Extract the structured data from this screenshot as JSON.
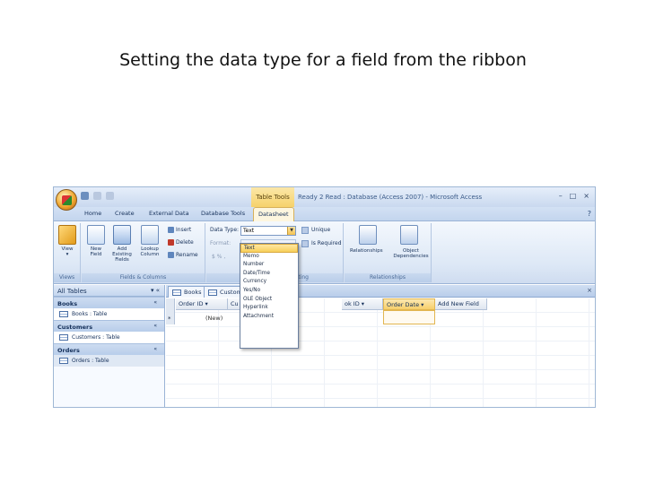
{
  "slide": {
    "title": "Setting the data type for a field from the ribbon"
  },
  "window": {
    "tool_context": "Table Tools",
    "title": "Ready 2 Read : Database (Access 2007) - Microsoft Access",
    "controls": [
      "–",
      "□",
      "×"
    ],
    "help": "?"
  },
  "ribbon": {
    "tabs": [
      "Home",
      "Create",
      "External Data",
      "Database Tools",
      "Datasheet"
    ],
    "active_tab": "Datasheet",
    "groups": {
      "views": {
        "label": "Views",
        "view_button": "View",
        "view_sub": "▾"
      },
      "fields_columns": {
        "label": "Fields & Columns",
        "new_field": "New Field",
        "add_existing": "Add Existing Fields",
        "lookup_column": "Lookup Column",
        "insert": "Insert",
        "delete": "Delete",
        "rename": "Rename"
      },
      "data_type": {
        "label_suffix": "ting",
        "data_type_label": "Data Type:",
        "data_type_value": "Text",
        "format_label": "Format:",
        "unique": "Unique",
        "is_required": "Is Required",
        "num_format": "$ % ,"
      },
      "relationships": {
        "label": "Relationships",
        "relationships": "Relationships",
        "object_dependencies": "Object Dependencies"
      }
    },
    "dropdown_options": [
      "Text",
      "Memo",
      "Number",
      "Date/Time",
      "Currency",
      "Yes/No",
      "OLE Object",
      "Hyperlink",
      "Attachment"
    ],
    "dropdown_selected": "Text"
  },
  "nav_pane": {
    "header": "All Tables",
    "header_ctrl": "▾  «",
    "groups": [
      {
        "name": "Books",
        "item": "Books : Table"
      },
      {
        "name": "Customers",
        "item": "Customers : Table"
      },
      {
        "name": "Orders",
        "item": "Orders : Table"
      }
    ],
    "chevron": "«"
  },
  "document": {
    "tabs": [
      "Books",
      "Custom"
    ],
    "close": "×",
    "columns": [
      "Order ID",
      "Cu",
      "ok ID",
      "Order Date",
      "Add New Field"
    ],
    "selected_column": "Order Date",
    "new_row_marker": "*",
    "new_row_value": "(New)"
  },
  "colors": {
    "ribbon_blue": "#dde8f6",
    "selection_gold": "#f8cf5b",
    "text_navy": "#15305a"
  }
}
